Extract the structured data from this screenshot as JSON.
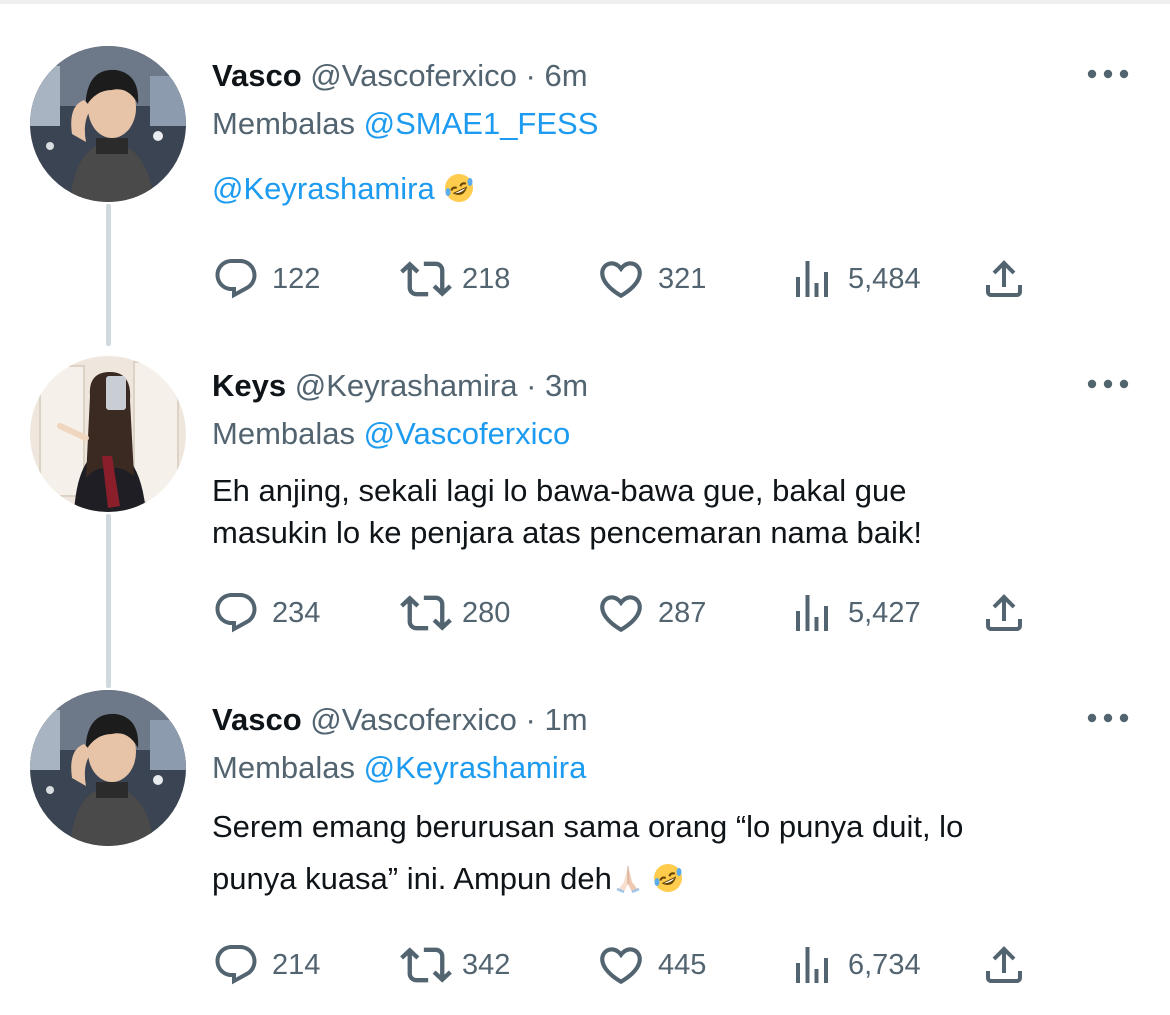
{
  "thread": [
    {
      "author": {
        "name": "Vasco",
        "handle": "@Vascoferxico"
      },
      "separator": "·",
      "time": "6m",
      "reply_prefix": "Membalas",
      "reply_to": "@SMAE1_FESS",
      "content": {
        "mention": "@Keyrashamira",
        "line1": "",
        "line2": "",
        "emojis": [
          "rofl"
        ]
      },
      "stats": {
        "replies": "122",
        "retweets": "218",
        "likes": "321",
        "views": "5,484"
      }
    },
    {
      "author": {
        "name": "Keys",
        "handle": "@Keyrashamira"
      },
      "separator": "·",
      "time": "3m",
      "reply_prefix": "Membalas",
      "reply_to": "@Vascoferxico",
      "content": {
        "line1": "Eh anjing, sekali lagi lo bawa-bawa gue, bakal gue",
        "line2": "masukin lo ke penjara atas pencemaran nama baik!",
        "emojis": []
      },
      "stats": {
        "replies": "234",
        "retweets": "280",
        "likes": "287",
        "views": "5,427"
      }
    },
    {
      "author": {
        "name": "Vasco",
        "handle": "@Vascoferxico"
      },
      "separator": "·",
      "time": "1m",
      "reply_prefix": "Membalas",
      "reply_to": "@Keyrashamira",
      "content": {
        "line1": "Serem emang berurusan sama orang “lo punya duit, lo",
        "line2": "punya kuasa” ini. Ampun deh",
        "emojis": [
          "folded-hands",
          "rofl"
        ]
      },
      "stats": {
        "replies": "214",
        "retweets": "342",
        "likes": "445",
        "views": "6,734"
      }
    }
  ],
  "colors": {
    "text": "#0f1419",
    "secondary": "#536471",
    "link": "#1d9bf0",
    "thread_line": "#cfd9de"
  },
  "icons": [
    "reply-icon",
    "retweet-icon",
    "like-icon",
    "views-icon",
    "share-icon",
    "more-icon"
  ]
}
